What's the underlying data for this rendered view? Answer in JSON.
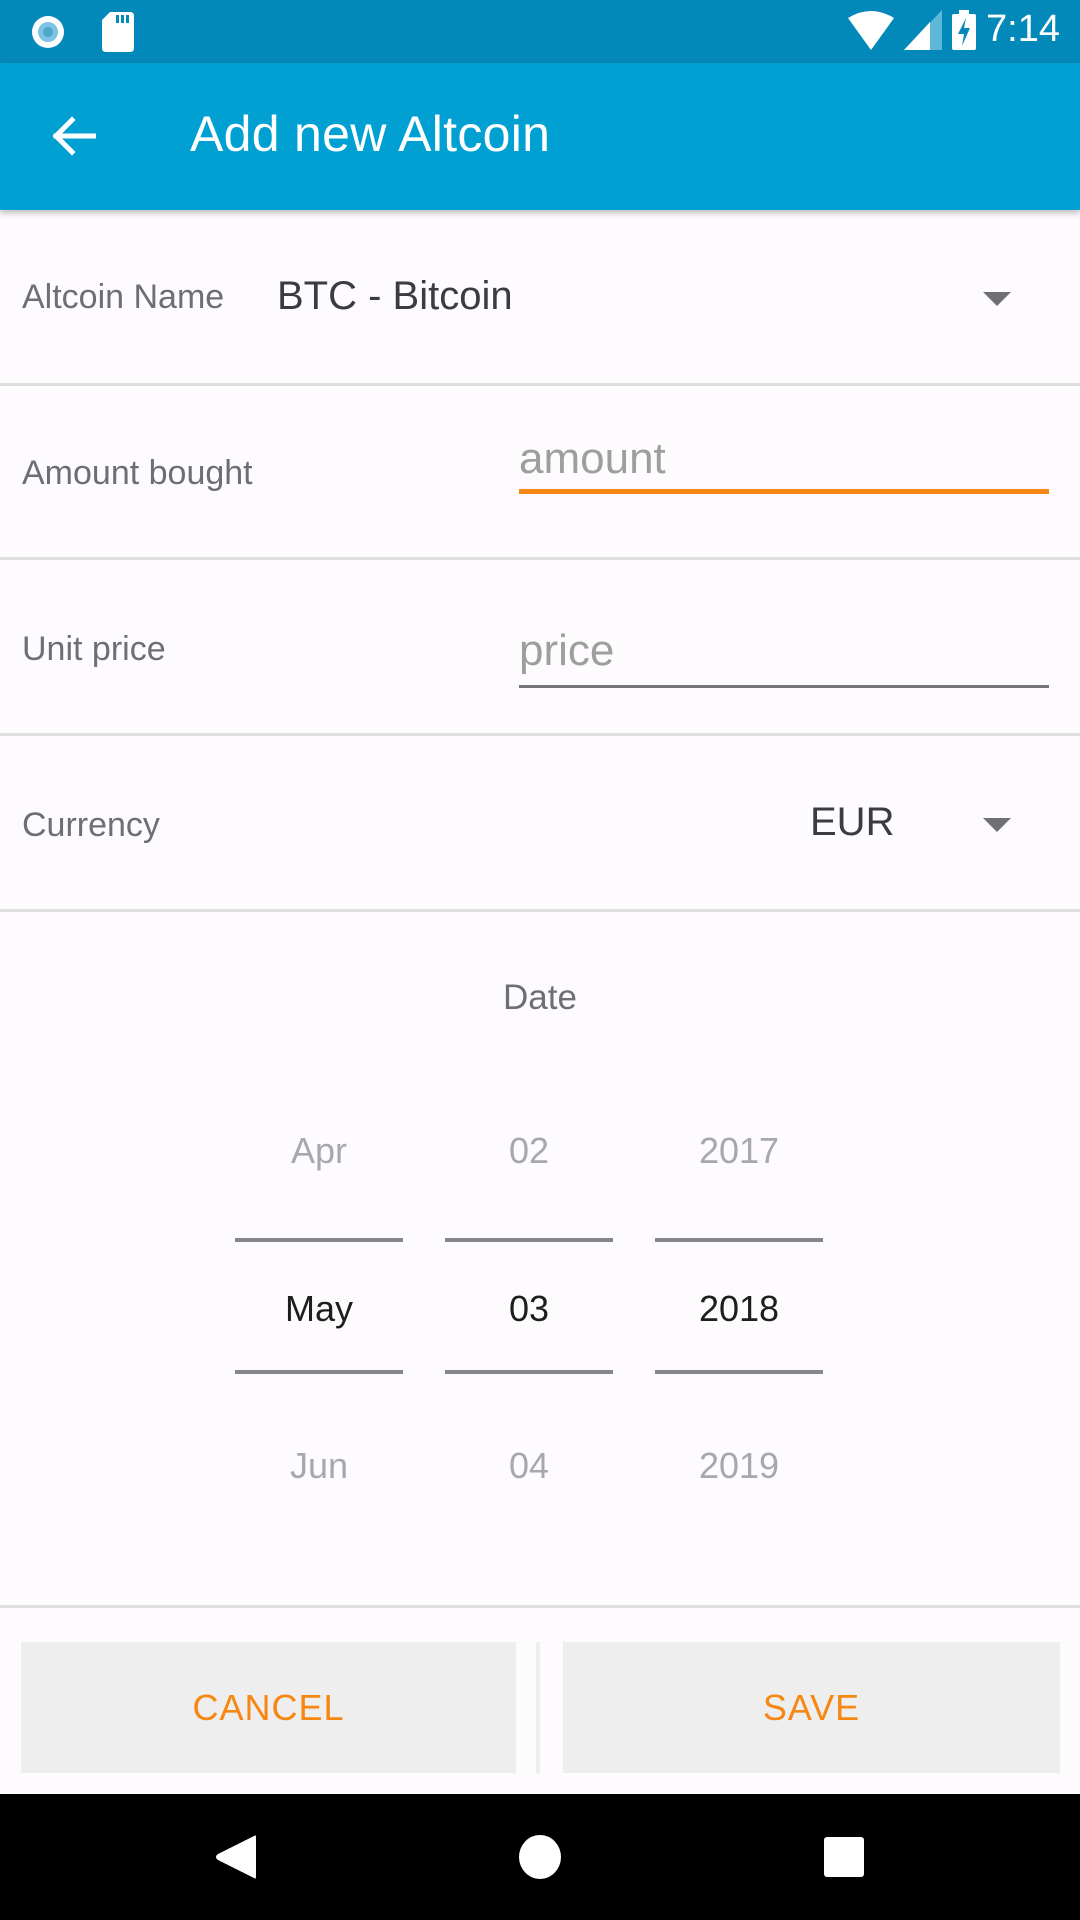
{
  "status_bar": {
    "time": "7:14",
    "icons": [
      "notification-circle-icon",
      "sd-card-icon",
      "wifi-icon",
      "cell-signal-icon",
      "battery-charging-icon"
    ]
  },
  "toolbar": {
    "back_icon": "arrow-back-icon",
    "title": "Add new Altcoin",
    "color": "#00a0d2"
  },
  "form": {
    "altcoin": {
      "label": "Altcoin Name",
      "value": "BTC - Bitcoin"
    },
    "amount": {
      "label": "Amount bought",
      "placeholder": "amount",
      "value": ""
    },
    "price": {
      "label": "Unit price",
      "placeholder": "price",
      "value": ""
    },
    "currency": {
      "label": "Currency",
      "value": "EUR"
    }
  },
  "date": {
    "label": "Date",
    "month": {
      "prev": "Apr",
      "selected": "May",
      "next": "Jun"
    },
    "day": {
      "prev": "02",
      "selected": "03",
      "next": "04"
    },
    "year": {
      "prev": "2017",
      "selected": "2018",
      "next": "2019"
    }
  },
  "actions": {
    "cancel_label": "CANCEL",
    "save_label": "SAVE",
    "accent": "#f68712"
  },
  "nav_bar": {
    "back": "nav-back-icon",
    "home": "nav-home-icon",
    "recents": "nav-recents-icon"
  }
}
